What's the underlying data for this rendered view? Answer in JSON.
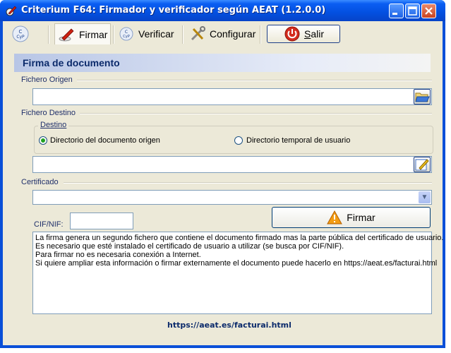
{
  "window": {
    "title": "Criterium F64: Firmador y verificador según AEAT (1.2.0.0)",
    "minimize_icon": "minimize-icon",
    "maximize_icon": "maximize-icon",
    "close_icon": "close-icon"
  },
  "toolbar": {
    "firmar_label": "Firmar",
    "verificar_label": "Verificar",
    "configurar_label": "Configurar",
    "salir_label": "Salir",
    "salir_mnemonic": "S",
    "salir_rest": "alir"
  },
  "panel": {
    "title": "Firma de documento",
    "fichero_origen_label": "Fichero Origen",
    "fichero_origen_value": "",
    "fichero_destino_label": "Fichero Destino",
    "destino_group_label": "Destino",
    "radio_options": [
      {
        "label": "Directorio del documento origen",
        "selected": true
      },
      {
        "label": "Directorio temporal de usuario",
        "selected": false
      }
    ],
    "destino_path_value": "",
    "certificado_label": "Certificado",
    "certificado_value": "",
    "cif_label": "CIF/NIF:",
    "cif_value": "",
    "firmar_button_label": "Firmar",
    "info_lines": [
      "La firma genera un segundo fichero que contiene el documento firmado mas la parte pública del certificado de usuario.",
      "Es necesario que esté instalado el certificado de usuario a utilizar (se busca por CIF/NIF).",
      "Para firmar no es necesaria conexión a Internet.",
      "Si quiere ampliar esta información o firmar externamente el documento puede hacerlo en https://aeat.es/facturai.html"
    ],
    "footer_link": "https://aeat.es/facturai.html"
  },
  "colors": {
    "titlebar": "#0350e0",
    "client_bg": "#ece9d8",
    "header_text": "#0b2a6b",
    "radio_selected": "#21a121"
  }
}
